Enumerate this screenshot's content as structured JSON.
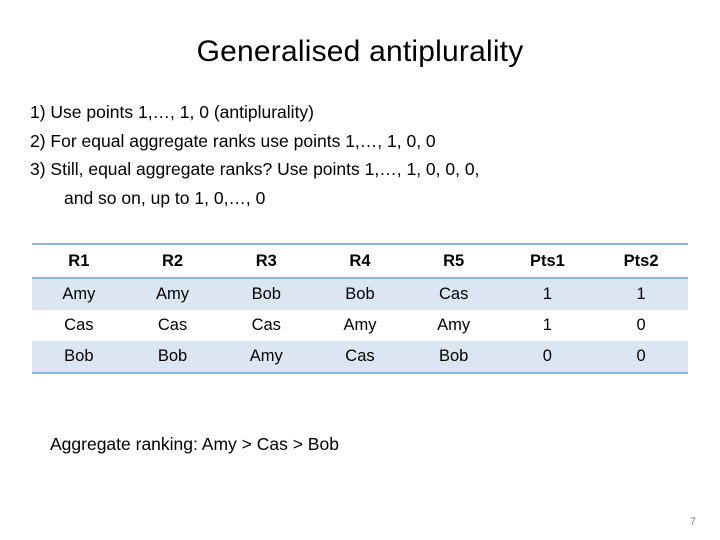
{
  "slide": {
    "title": "Generalised antiplurality",
    "bullets": [
      {
        "text": "1) Use points 1,…, 1, 0 (antiplurality)",
        "indented": false
      },
      {
        "text": "2) For equal aggregate ranks use points 1,…, 1, 0, 0",
        "indented": false
      },
      {
        "text": "3) Still, equal aggregate ranks? Use points 1,…, 1, 0, 0, 0,",
        "indented": false
      },
      {
        "text": "and so on, up to 1, 0,…, 0",
        "indented": true
      }
    ],
    "table": {
      "headers": [
        "R1",
        "R2",
        "R3",
        "R4",
        "R5",
        "Pts1",
        "Pts2"
      ],
      "rows": [
        [
          "Amy",
          "Amy",
          "Bob",
          "Bob",
          "Cas",
          "1",
          "1"
        ],
        [
          "Cas",
          "Cas",
          "Cas",
          "Amy",
          "Amy",
          "1",
          "0"
        ],
        [
          "Bob",
          "Bob",
          "Amy",
          "Cas",
          "Bob",
          "0",
          "0"
        ]
      ]
    },
    "aggregate_text": "Aggregate ranking: Amy > Cas > Bob",
    "page_number": "7"
  }
}
